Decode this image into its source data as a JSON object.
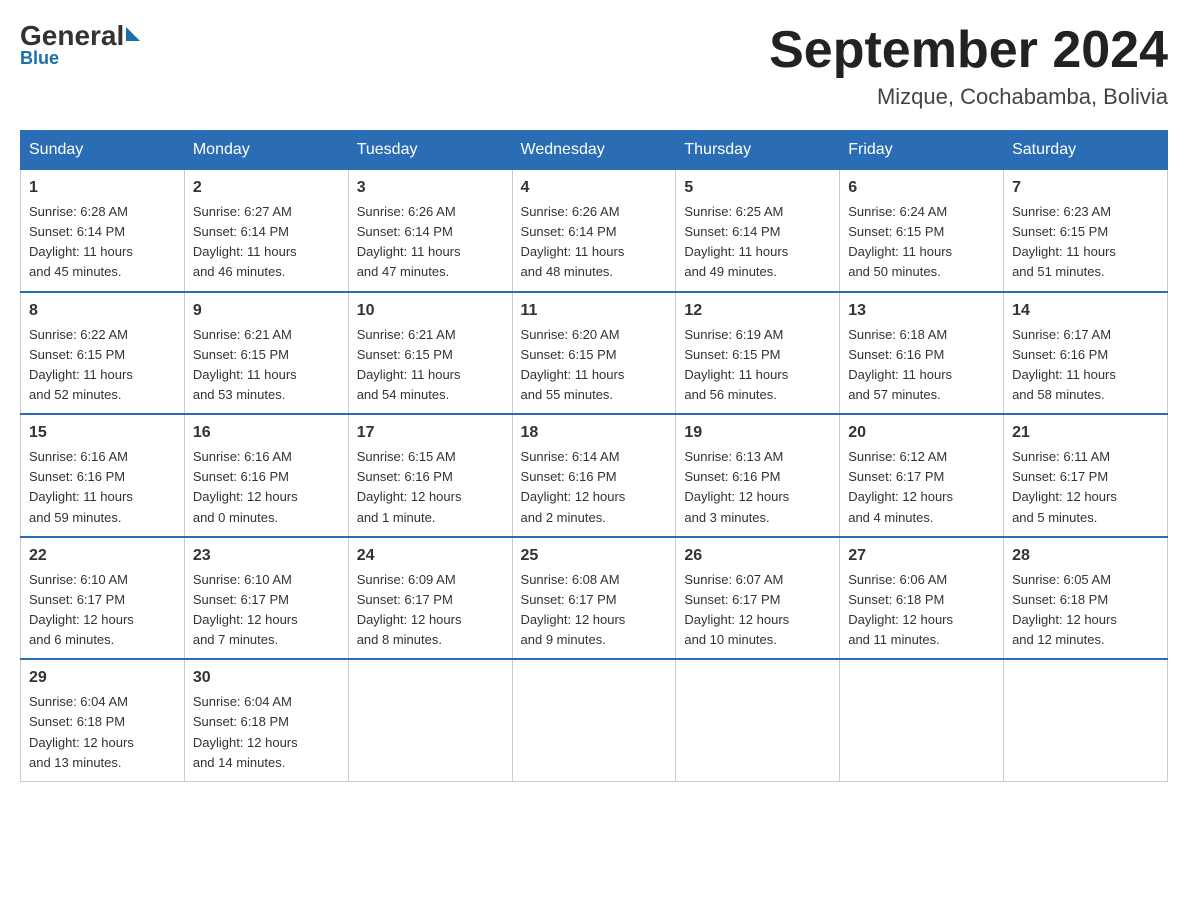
{
  "header": {
    "logo": {
      "general": "General",
      "blue": "Blue"
    },
    "title": "September 2024",
    "location": "Mizque, Cochabamba, Bolivia"
  },
  "weekdays": [
    "Sunday",
    "Monday",
    "Tuesday",
    "Wednesday",
    "Thursday",
    "Friday",
    "Saturday"
  ],
  "weeks": [
    [
      {
        "day": "1",
        "sunrise": "6:28 AM",
        "sunset": "6:14 PM",
        "daylight": "11 hours and 45 minutes."
      },
      {
        "day": "2",
        "sunrise": "6:27 AM",
        "sunset": "6:14 PM",
        "daylight": "11 hours and 46 minutes."
      },
      {
        "day": "3",
        "sunrise": "6:26 AM",
        "sunset": "6:14 PM",
        "daylight": "11 hours and 47 minutes."
      },
      {
        "day": "4",
        "sunrise": "6:26 AM",
        "sunset": "6:14 PM",
        "daylight": "11 hours and 48 minutes."
      },
      {
        "day": "5",
        "sunrise": "6:25 AM",
        "sunset": "6:14 PM",
        "daylight": "11 hours and 49 minutes."
      },
      {
        "day": "6",
        "sunrise": "6:24 AM",
        "sunset": "6:15 PM",
        "daylight": "11 hours and 50 minutes."
      },
      {
        "day": "7",
        "sunrise": "6:23 AM",
        "sunset": "6:15 PM",
        "daylight": "11 hours and 51 minutes."
      }
    ],
    [
      {
        "day": "8",
        "sunrise": "6:22 AM",
        "sunset": "6:15 PM",
        "daylight": "11 hours and 52 minutes."
      },
      {
        "day": "9",
        "sunrise": "6:21 AM",
        "sunset": "6:15 PM",
        "daylight": "11 hours and 53 minutes."
      },
      {
        "day": "10",
        "sunrise": "6:21 AM",
        "sunset": "6:15 PM",
        "daylight": "11 hours and 54 minutes."
      },
      {
        "day": "11",
        "sunrise": "6:20 AM",
        "sunset": "6:15 PM",
        "daylight": "11 hours and 55 minutes."
      },
      {
        "day": "12",
        "sunrise": "6:19 AM",
        "sunset": "6:15 PM",
        "daylight": "11 hours and 56 minutes."
      },
      {
        "day": "13",
        "sunrise": "6:18 AM",
        "sunset": "6:16 PM",
        "daylight": "11 hours and 57 minutes."
      },
      {
        "day": "14",
        "sunrise": "6:17 AM",
        "sunset": "6:16 PM",
        "daylight": "11 hours and 58 minutes."
      }
    ],
    [
      {
        "day": "15",
        "sunrise": "6:16 AM",
        "sunset": "6:16 PM",
        "daylight": "11 hours and 59 minutes."
      },
      {
        "day": "16",
        "sunrise": "6:16 AM",
        "sunset": "6:16 PM",
        "daylight": "12 hours and 0 minutes."
      },
      {
        "day": "17",
        "sunrise": "6:15 AM",
        "sunset": "6:16 PM",
        "daylight": "12 hours and 1 minute."
      },
      {
        "day": "18",
        "sunrise": "6:14 AM",
        "sunset": "6:16 PM",
        "daylight": "12 hours and 2 minutes."
      },
      {
        "day": "19",
        "sunrise": "6:13 AM",
        "sunset": "6:16 PM",
        "daylight": "12 hours and 3 minutes."
      },
      {
        "day": "20",
        "sunrise": "6:12 AM",
        "sunset": "6:17 PM",
        "daylight": "12 hours and 4 minutes."
      },
      {
        "day": "21",
        "sunrise": "6:11 AM",
        "sunset": "6:17 PM",
        "daylight": "12 hours and 5 minutes."
      }
    ],
    [
      {
        "day": "22",
        "sunrise": "6:10 AM",
        "sunset": "6:17 PM",
        "daylight": "12 hours and 6 minutes."
      },
      {
        "day": "23",
        "sunrise": "6:10 AM",
        "sunset": "6:17 PM",
        "daylight": "12 hours and 7 minutes."
      },
      {
        "day": "24",
        "sunrise": "6:09 AM",
        "sunset": "6:17 PM",
        "daylight": "12 hours and 8 minutes."
      },
      {
        "day": "25",
        "sunrise": "6:08 AM",
        "sunset": "6:17 PM",
        "daylight": "12 hours and 9 minutes."
      },
      {
        "day": "26",
        "sunrise": "6:07 AM",
        "sunset": "6:17 PM",
        "daylight": "12 hours and 10 minutes."
      },
      {
        "day": "27",
        "sunrise": "6:06 AM",
        "sunset": "6:18 PM",
        "daylight": "12 hours and 11 minutes."
      },
      {
        "day": "28",
        "sunrise": "6:05 AM",
        "sunset": "6:18 PM",
        "daylight": "12 hours and 12 minutes."
      }
    ],
    [
      {
        "day": "29",
        "sunrise": "6:04 AM",
        "sunset": "6:18 PM",
        "daylight": "12 hours and 13 minutes."
      },
      {
        "day": "30",
        "sunrise": "6:04 AM",
        "sunset": "6:18 PM",
        "daylight": "12 hours and 14 minutes."
      },
      null,
      null,
      null,
      null,
      null
    ]
  ],
  "labels": {
    "sunrise": "Sunrise:",
    "sunset": "Sunset:",
    "daylight": "Daylight:"
  }
}
